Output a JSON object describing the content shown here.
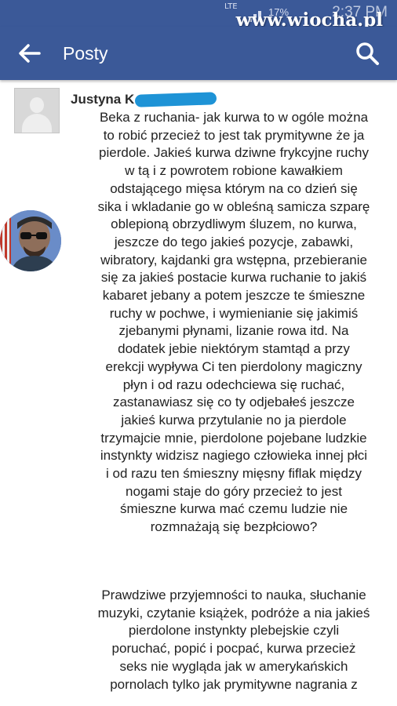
{
  "status_bar": {
    "network": "LTE",
    "battery": "17%",
    "time": "2:37 PM",
    "watermark": "www.wiocha.pl"
  },
  "app_bar": {
    "title": "Posty",
    "back_icon": "arrow-left-icon",
    "search_icon": "search-icon"
  },
  "post": {
    "author": "Justyna K",
    "paragraph1": "Beka z ruchania- jak kurwa to w ogóle można\nto robić przecież to jest tak prymitywne że ja\npierdole. Jakieś kurwa dziwne frykcyjne ruchy\nw tą i z powrotem robione kawałkiem\nodstającego mięsa którym na co dzień się\nsika i wkladanie go w obleśną samicza szparę\noblepioną obrzydliwym śluzem, no kurwa,\njeszcze do tego jakieś pozycje, zabawki,\nwibratory, kajdanki gra wstępna, przebieranie\nsię za jakieś postacie kurwa ruchanie to jakiś\nkabaret jebany a potem jeszcze te śmieszne\nruchy w pochwe, i wymienianie się jakimiś\nzjebanymi płynami, lizanie rowa itd. Na\ndodatek jebie niektórym stamtąd a przy\nerekcji wypływa Ci ten pierdolony magiczny\npłyn i od razu odechciewa się ruchać,\nzastanawiasz się co ty odjebałeś jeszcze\njakieś kurwa przytulanie no ja pierdole\ntrzymajcie mnie, pierdolone pojebane ludzkie\ninstynkty widzisz nagiego człowieka innej płci\ni od razu ten śmieszny mięsny fiflak między\nnogami staje do góry przecież to jest\nśmieszne kurwa mać czemu ludzie nie\nrozmnażają się bezpłciowo?",
    "paragraph2": "Prawdziwe przyjemności to nauka, słuchanie\nmuzyki, czytanie książek, podróże a nia jakieś\npierdolone instynkty plebejskie czyli\nporuchać, popić i pocpać, kurwa przecież\nseks nie wygląda jak w amerykańskich\npornolach tylko jak prymitywne nagrania z"
  },
  "colors": {
    "app_bar": "#3b5998",
    "text": "#222222",
    "redaction": "#1e93d6"
  }
}
